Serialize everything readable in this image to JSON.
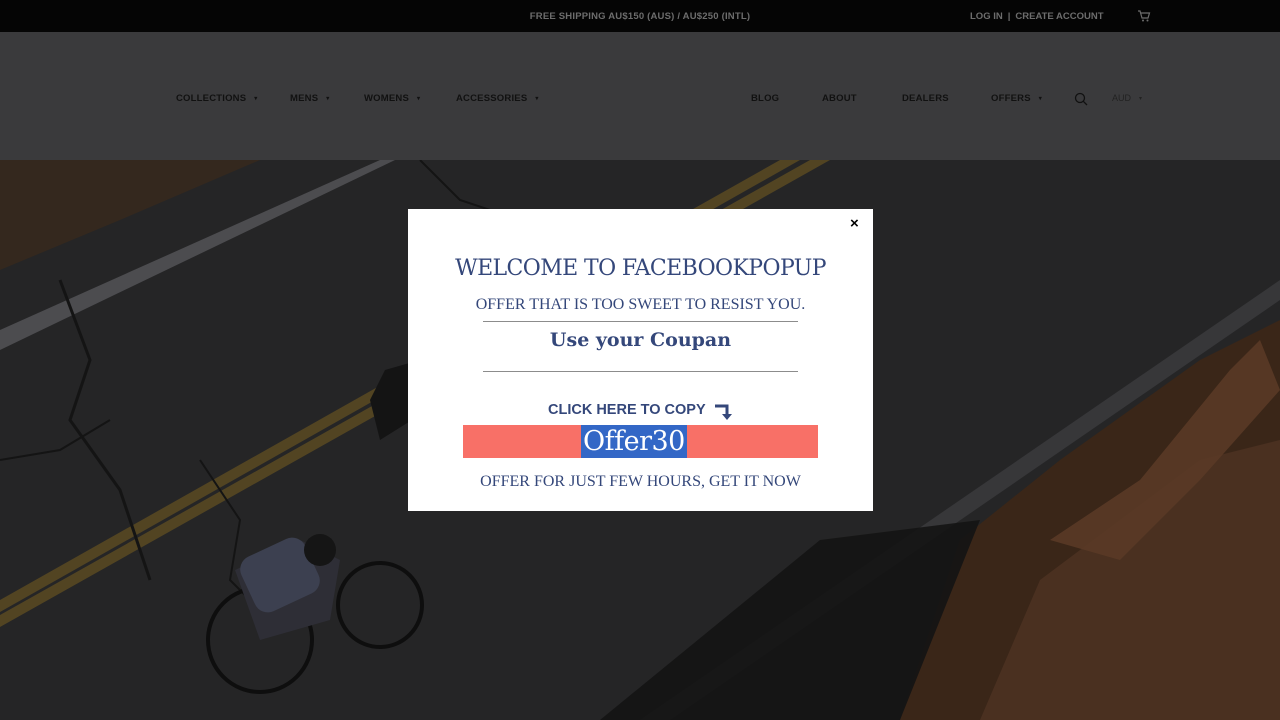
{
  "topbar": {
    "shipping": "FREE SHIPPING AU$150 (AUS) / AU$250 (INTL)",
    "login": "LOG IN",
    "separator": "|",
    "create_account": "CREATE ACCOUNT",
    "cart_icon": "cart-icon"
  },
  "nav": {
    "left": [
      {
        "label": "COLLECTIONS",
        "has_dropdown": true
      },
      {
        "label": "MENS",
        "has_dropdown": true
      },
      {
        "label": "WOMENS",
        "has_dropdown": true
      },
      {
        "label": "ACCESSORIES",
        "has_dropdown": true
      }
    ],
    "right": [
      {
        "label": "BLOG",
        "has_dropdown": false
      },
      {
        "label": "ABOUT",
        "has_dropdown": false
      },
      {
        "label": "DEALERS",
        "has_dropdown": false
      },
      {
        "label": "OFFERS",
        "has_dropdown": true
      }
    ],
    "search_icon": "search-icon",
    "currency": "AUD",
    "caret": "▾"
  },
  "popup": {
    "close": "×",
    "title": "WELCOME TO FACEBOOKPOPUP",
    "subtitle": "OFFER THAT IS TOO SWEET TO RESIST YOU.",
    "coupon_heading": "Use your Coupan",
    "click_to_copy": "CLICK HERE TO COPY",
    "code": "Offer30",
    "footer": "OFFER FOR JUST FEW HOURS, GET IT NOW"
  },
  "colors": {
    "popup_text": "#34477a",
    "code_bar": "#f87067",
    "code_highlight": "#3367c6"
  }
}
